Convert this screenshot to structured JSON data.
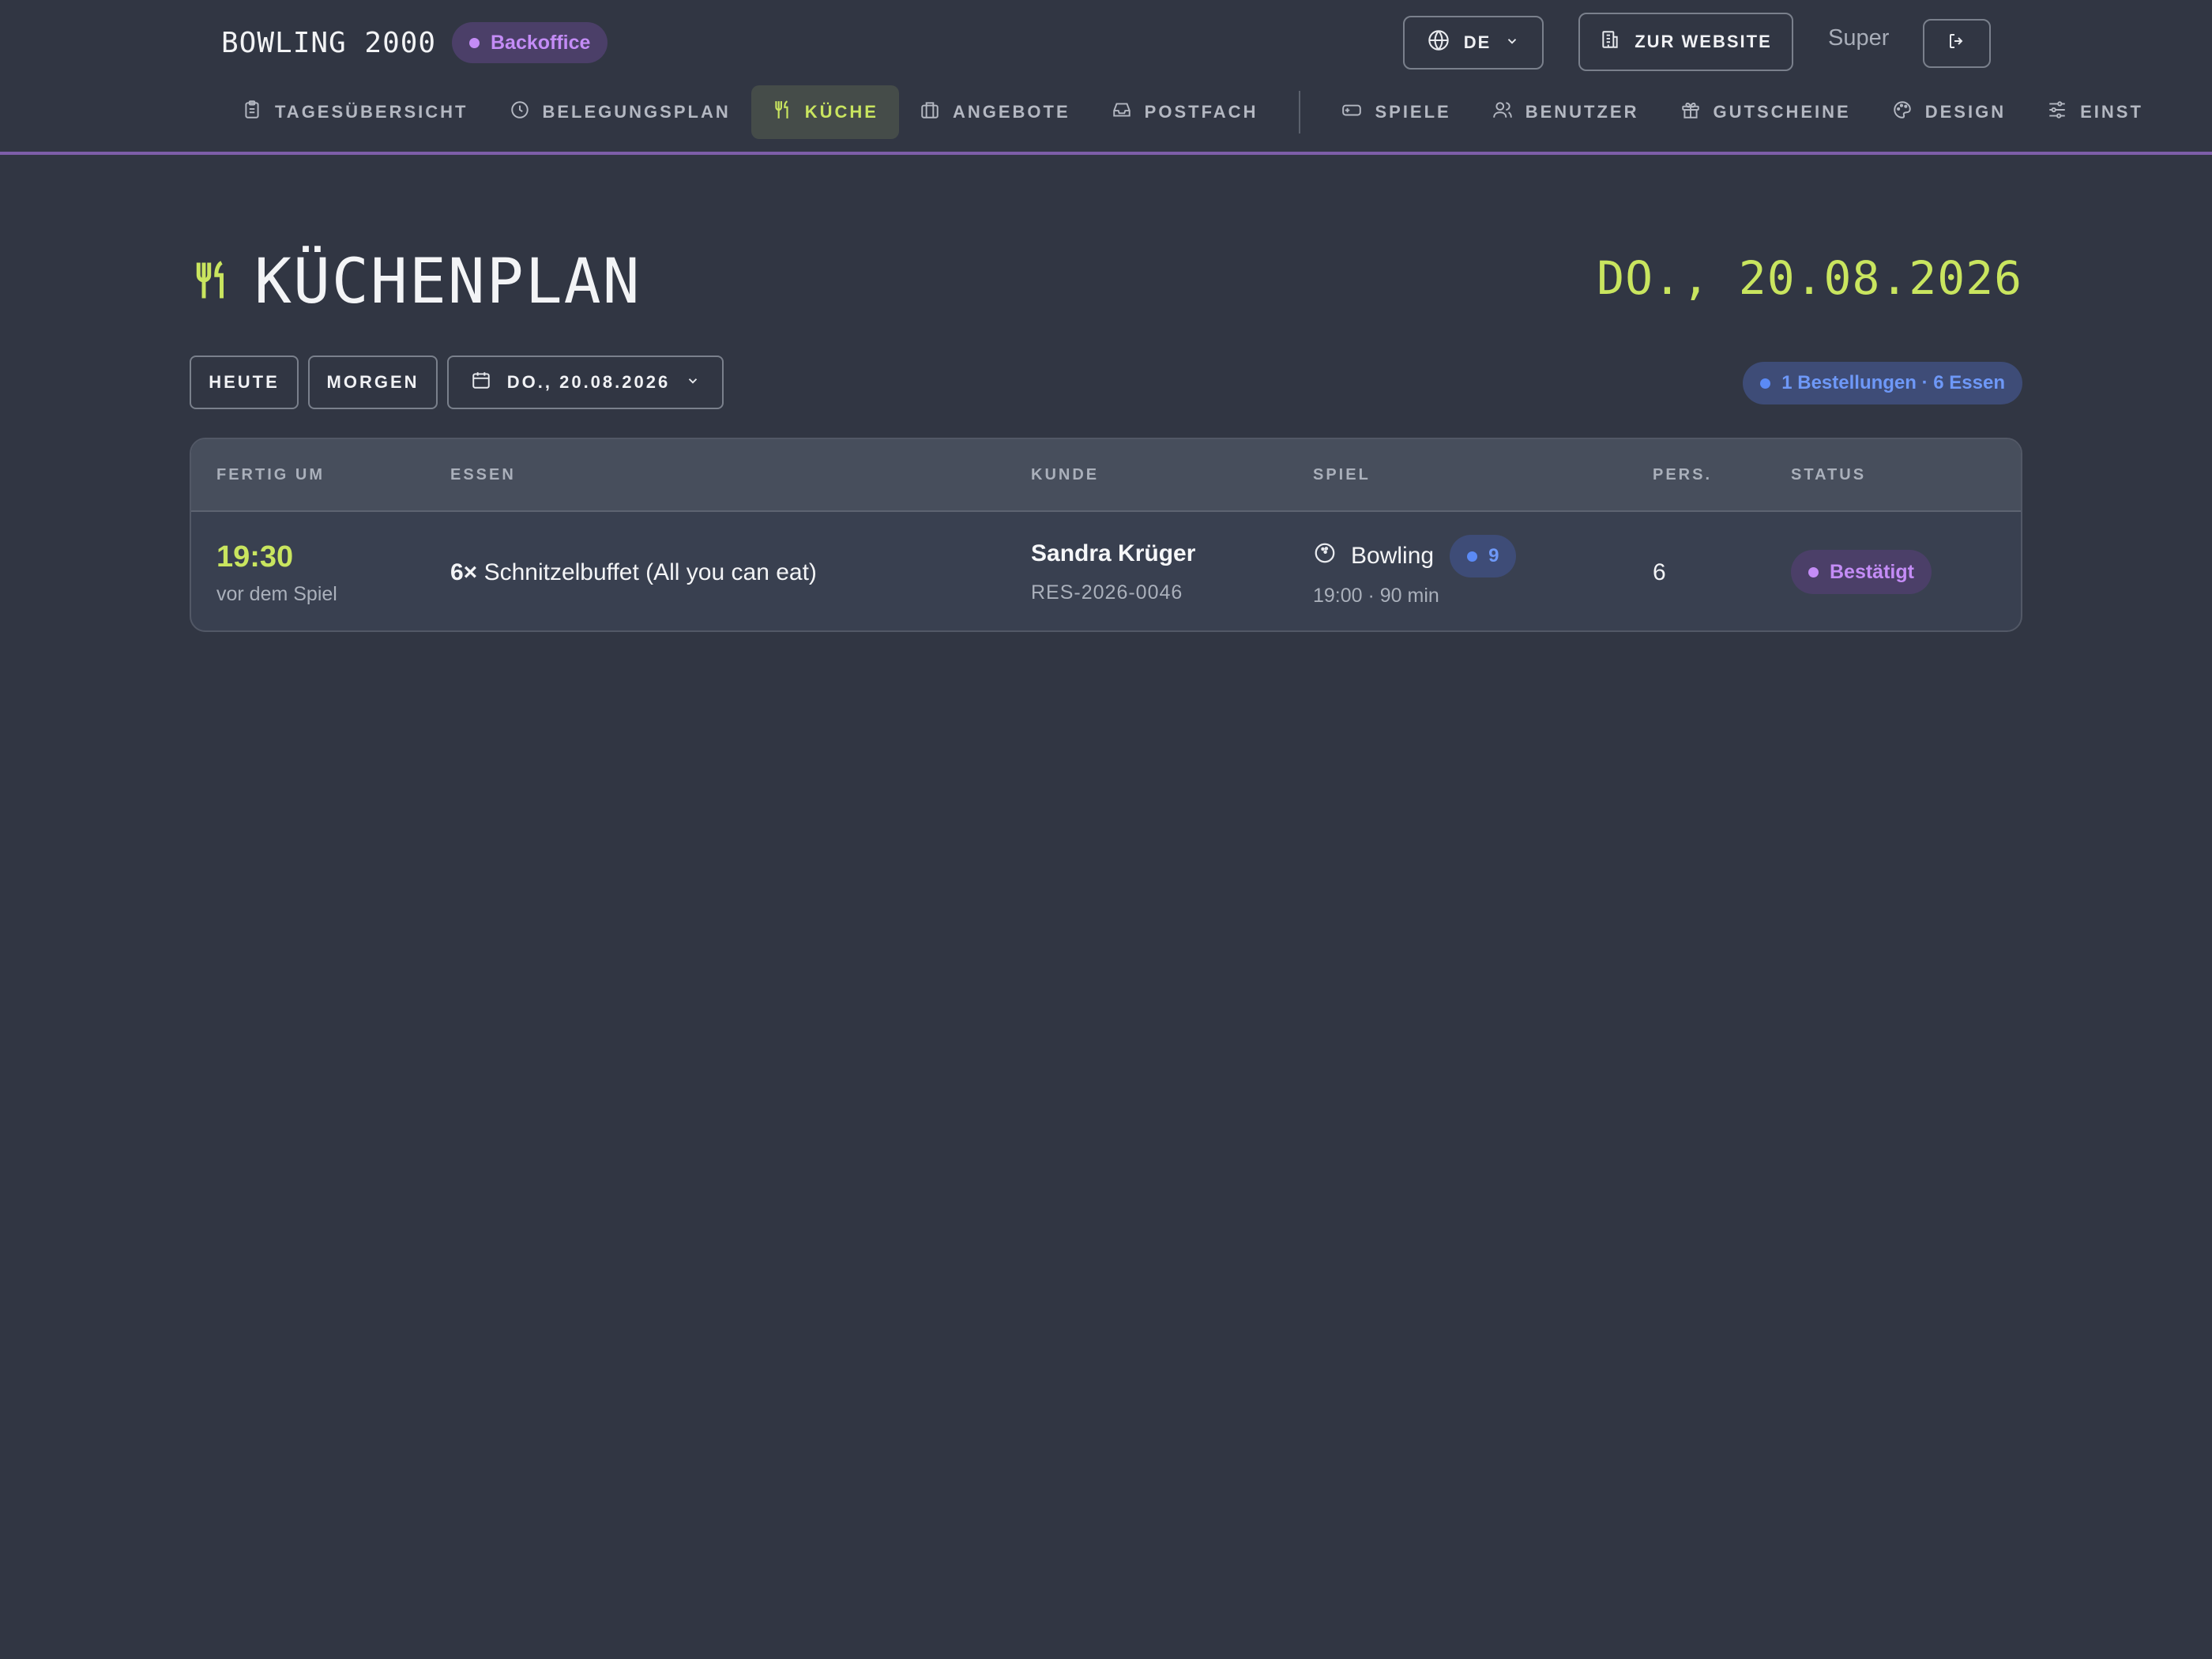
{
  "header": {
    "brand": "BOWLING 2000",
    "badge": "Backoffice",
    "language": "DE",
    "website_button": "ZUR WEBSITE",
    "user": "Super"
  },
  "nav": {
    "items": [
      {
        "label": "TAGESÜBERSICHT",
        "icon": "clipboard-icon"
      },
      {
        "label": "BELEGUNGSPLAN",
        "icon": "clock-icon"
      },
      {
        "label": "KÜCHE",
        "icon": "utensils-icon",
        "active": true
      },
      {
        "label": "ANGEBOTE",
        "icon": "briefcase-icon"
      },
      {
        "label": "POSTFACH",
        "icon": "inbox-icon"
      },
      {
        "label": "SPIELE",
        "icon": "gamepad-icon"
      },
      {
        "label": "BENUTZER",
        "icon": "users-icon"
      },
      {
        "label": "GUTSCHEINE",
        "icon": "gift-icon"
      },
      {
        "label": "DESIGN",
        "icon": "palette-icon"
      },
      {
        "label": "EINST",
        "icon": "sliders-icon"
      }
    ]
  },
  "page": {
    "title": "KÜCHENPLAN",
    "date": "DO., 20.08.2026",
    "filters": {
      "today": "HEUTE",
      "tomorrow": "MORGEN",
      "date_picker": "DO., 20.08.2026"
    },
    "summary": "1 Bestellungen · 6 Essen"
  },
  "table": {
    "columns": [
      "FERTIG UM",
      "ESSEN",
      "KUNDE",
      "SPIEL",
      "PERS.",
      "STATUS"
    ],
    "rows": [
      {
        "time": "19:30",
        "time_note": "vor dem Spiel",
        "qty": "6×",
        "dish": "Schnitzelbuffet (All you can eat)",
        "customer": "Sandra Krüger",
        "reference": "RES-2026-0046",
        "game": "Bowling",
        "lane": "9",
        "game_info": "19:00 · 90 min",
        "persons": "6",
        "status": "Bestätigt"
      }
    ]
  },
  "colors": {
    "background": "#313643",
    "accent_lime": "#c9e55f",
    "accent_purple": "#c48cf6",
    "accent_blue": "#6e98f7",
    "header_border": "#7d5ea9"
  }
}
